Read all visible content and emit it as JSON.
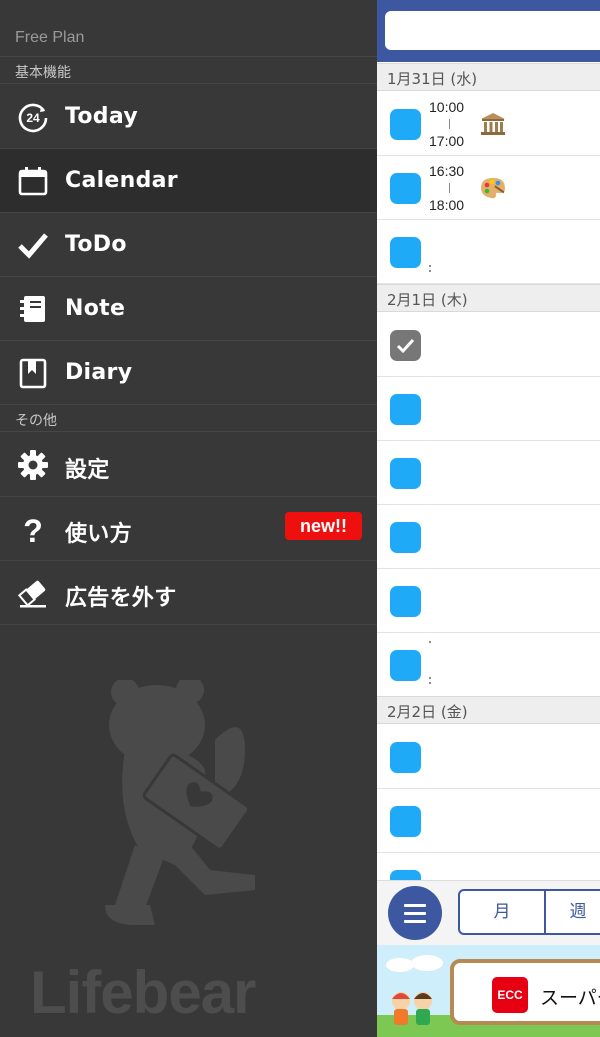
{
  "drawer": {
    "plan_label": "Free Plan",
    "section_basic": "基本機能",
    "section_other": "その他",
    "items": [
      {
        "label": "Today",
        "icon": "today-24-icon"
      },
      {
        "label": "Calendar",
        "icon": "calendar-icon"
      },
      {
        "label": "ToDo",
        "icon": "checkmark-icon"
      },
      {
        "label": "Note",
        "icon": "notebook-icon"
      },
      {
        "label": "Diary",
        "icon": "bookmark-book-icon"
      },
      {
        "label": "設定",
        "icon": "gear-icon"
      },
      {
        "label": "使い方",
        "icon": "question-icon",
        "badge": "new!!"
      },
      {
        "label": "広告を外す",
        "icon": "eraser-icon"
      }
    ],
    "brand": "Lifebear"
  },
  "content": {
    "days": [
      {
        "label": "1月31日 (水)"
      },
      {
        "label": "2月1日 (木)"
      },
      {
        "label": "2月2日 (金)"
      }
    ],
    "events": [
      {
        "start": "10:00",
        "end": "17:00",
        "icon": "museum-icon"
      },
      {
        "start": "16:30",
        "end": "18:00",
        "icon": "palette-icon"
      }
    ],
    "tabs": {
      "month": "月",
      "week": "週"
    },
    "ad": {
      "brand": "ECC",
      "text": "スーパー"
    }
  },
  "colors": {
    "drawer_bg": "#383838",
    "header_blue": "#3d57a0",
    "checkbox_blue": "#1eaaf7",
    "badge_red": "#ee0f0f"
  }
}
